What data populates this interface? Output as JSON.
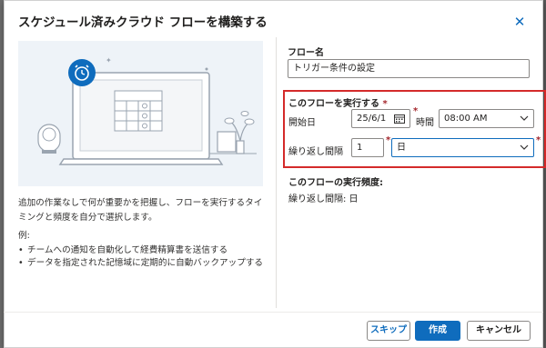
{
  "dialog": {
    "title": "スケジュール済みクラウド フローを構築する",
    "close_icon": "close-icon"
  },
  "left": {
    "description": "追加の作業なしで何が重要かを把握し、フローを実行するタイミングと頻度を自分で選択します。",
    "examples_heading": "例:",
    "examples": [
      "チームへの通知を自動化して経費精算書を送信する",
      "データを指定された記憶域に定期的に自動バックアップする"
    ]
  },
  "form": {
    "flow_name_label": "フロー名",
    "flow_name_value": "トリガー条件の設定",
    "run_label": "このフローを実行する",
    "required_mark": "*",
    "start_date_label": "開始日",
    "start_date_value": "25/6/1",
    "time_label": "時間",
    "time_value": "08:00 AM",
    "repeat_label": "繰り返し間隔",
    "repeat_count": "1",
    "repeat_unit": "日",
    "frequency_heading": "このフローの実行頻度:",
    "frequency_text": "繰り返し間隔: 日"
  },
  "footer": {
    "skip_label": "スキップ",
    "create_label": "作成",
    "cancel_label": "キャンセル"
  },
  "colors": {
    "accent": "#0f6cbd",
    "highlight_border": "#d42a2a",
    "illustration_bg": "#eef3f8"
  }
}
